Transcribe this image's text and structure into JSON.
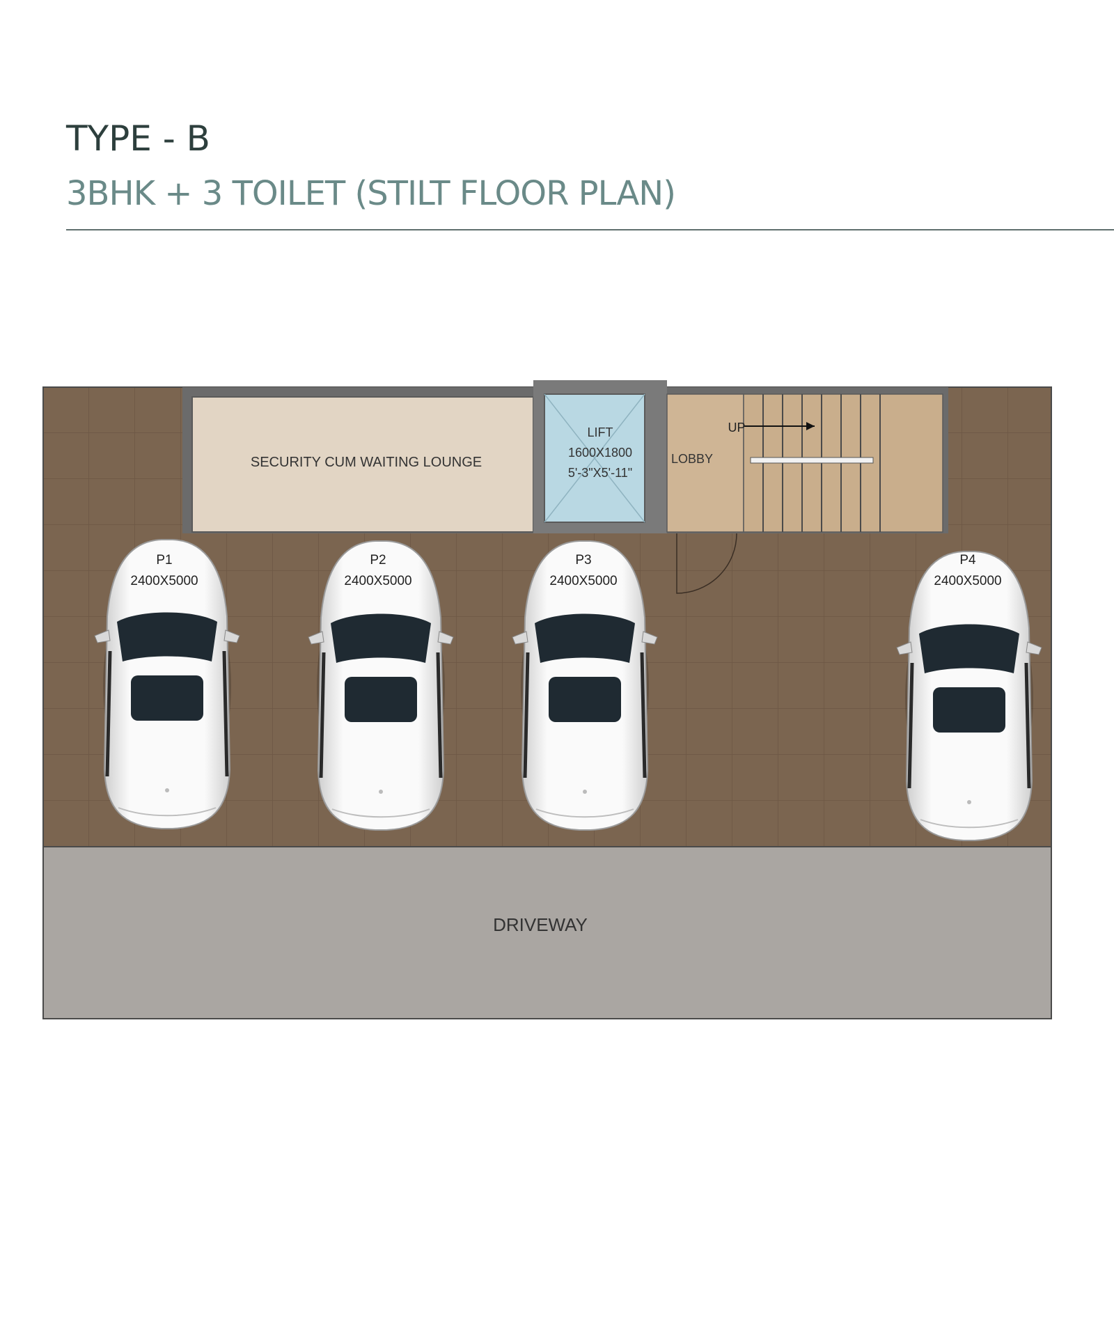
{
  "header": {
    "title": "TYPE - B",
    "subtitle": "3BHK + 3 TOILET (STILT FLOOR PLAN)"
  },
  "rooms": {
    "lounge": "SECURITY CUM WAITING LOUNGE",
    "lift": {
      "name": "LIFT",
      "size_mm": "1600X1800",
      "size_ft": "5'-3\"X5'-11\""
    },
    "lobby": "LOBBY",
    "stair_label": "UP",
    "driveway": "DRIVEWAY"
  },
  "parking": [
    {
      "id": "P1",
      "size": "2400X5000"
    },
    {
      "id": "P2",
      "size": "2400X5000"
    },
    {
      "id": "P3",
      "size": "2400X5000"
    },
    {
      "id": "P4",
      "size": "2400X5000"
    }
  ],
  "colors": {
    "parking_floor": "#7b6550",
    "lounge_floor": "#e2d5c4",
    "lift_fill": "#b9d8e3",
    "stair_floor": "#cfb595",
    "driveway": "#aaa6a2",
    "car_body": "#f4f4f4",
    "car_glass": "#1f2a32"
  }
}
